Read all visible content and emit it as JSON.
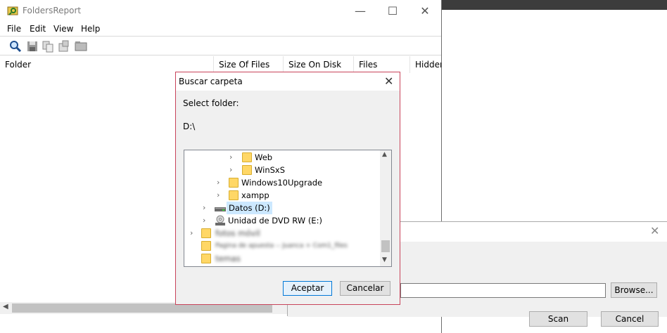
{
  "app": {
    "title": "FoldersReport",
    "menu": [
      "File",
      "Edit",
      "View",
      "Help"
    ],
    "columns": [
      "Folder",
      "Size Of Files",
      "Size On Disk",
      "Files",
      "Hidden"
    ]
  },
  "dialog": {
    "title": "Buscar carpeta",
    "label": "Select folder:",
    "path": "D:\\",
    "tree": [
      {
        "label": "Web",
        "icon": "folder-icon"
      },
      {
        "label": "WinSxS",
        "icon": "folder-icon"
      },
      {
        "label": "Windows10Upgrade",
        "icon": "folder-icon"
      },
      {
        "label": "xampp",
        "icon": "folder-icon"
      },
      {
        "label": "Datos (D:)",
        "icon": "drive-icon",
        "selected": true
      },
      {
        "label": "Unidad de DVD RW (E:)",
        "icon": "dvd-icon"
      },
      {
        "label": "fotos móvil",
        "icon": "folder-icon",
        "blurred": true
      },
      {
        "label": "Pagina de apuesta -- Juanca + Com1_files",
        "icon": "folder-icon",
        "blurred": true
      },
      {
        "label": "temas",
        "icon": "folder-icon",
        "blurred": true
      }
    ],
    "ok_label": "Aceptar",
    "cancel_label": "Cancelar"
  },
  "scan_dialog": {
    "browse_label": "Browse...",
    "scan_label": "Scan",
    "cancel_label": "Cancel"
  }
}
